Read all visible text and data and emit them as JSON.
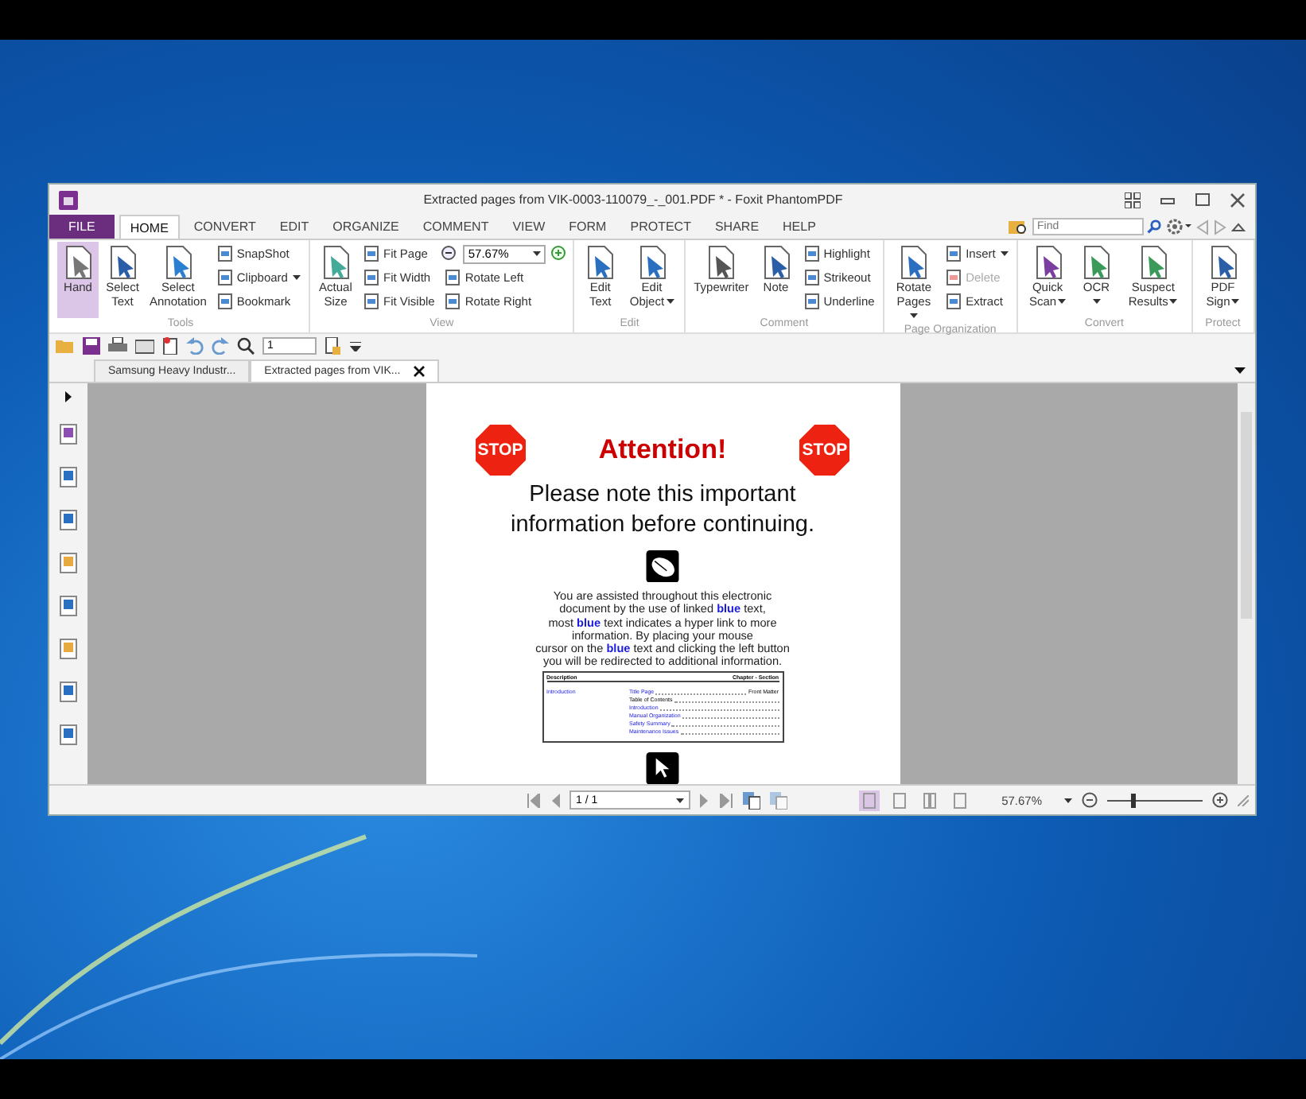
{
  "window": {
    "title": "Extracted pages from VIK-0003-110079_-_001.PDF * - Foxit PhantomPDF"
  },
  "menu_tabs": [
    {
      "label": "FILE",
      "kind": "file",
      "selected": false
    },
    {
      "label": "HOME",
      "kind": "tab",
      "selected": true
    },
    {
      "label": "CONVERT",
      "kind": "tab",
      "selected": false
    },
    {
      "label": "EDIT",
      "kind": "tab",
      "selected": false
    },
    {
      "label": "ORGANIZE",
      "kind": "tab",
      "selected": false
    },
    {
      "label": "COMMENT",
      "kind": "tab",
      "selected": false
    },
    {
      "label": "VIEW",
      "kind": "tab",
      "selected": false
    },
    {
      "label": "FORM",
      "kind": "tab",
      "selected": false
    },
    {
      "label": "PROTECT",
      "kind": "tab",
      "selected": false
    },
    {
      "label": "SHARE",
      "kind": "tab",
      "selected": false
    },
    {
      "label": "HELP",
      "kind": "tab",
      "selected": false
    }
  ],
  "search": {
    "placeholder": "Find"
  },
  "ribbon": [
    {
      "label": "Tools",
      "items": [
        {
          "kind": "big",
          "label": "Hand",
          "selected": true,
          "dropdown": false
        },
        {
          "kind": "big",
          "label": "Select Text",
          "selected": false,
          "dropdown": false
        },
        {
          "kind": "big",
          "label": "Select Annotation",
          "selected": false,
          "dropdown": false
        },
        {
          "kind": "column",
          "items": [
            {
              "kind": "small",
              "label": "SnapShot",
              "dropdown": false,
              "disabled": false
            },
            {
              "kind": "small",
              "label": "Clipboard",
              "dropdown": true,
              "disabled": false
            },
            {
              "kind": "small",
              "label": "Bookmark",
              "dropdown": false,
              "disabled": false
            }
          ]
        }
      ]
    },
    {
      "label": "View",
      "items": [
        {
          "kind": "big",
          "label": "Actual Size",
          "selected": false,
          "dropdown": false
        },
        {
          "kind": "column",
          "items": [
            {
              "kind": "small",
              "label": "Fit Page",
              "dropdown": false,
              "disabled": false
            },
            {
              "kind": "small",
              "label": "Fit Width",
              "dropdown": false,
              "disabled": false
            },
            {
              "kind": "small",
              "label": "Fit Visible",
              "dropdown": false,
              "disabled": false
            }
          ]
        },
        {
          "kind": "column",
          "items": [
            {
              "kind": "zoom",
              "value": "57.67%"
            },
            {
              "kind": "small",
              "label": "Rotate Left",
              "dropdown": false,
              "disabled": false
            },
            {
              "kind": "small",
              "label": "Rotate Right",
              "dropdown": false,
              "disabled": false
            }
          ]
        }
      ]
    },
    {
      "label": "Edit",
      "items": [
        {
          "kind": "big",
          "label": "Edit Text",
          "selected": false,
          "dropdown": false
        },
        {
          "kind": "big",
          "label": "Edit Object",
          "selected": false,
          "dropdown": true
        }
      ]
    },
    {
      "label": "Comment",
      "items": [
        {
          "kind": "big",
          "label": "Typewriter",
          "selected": false,
          "dropdown": false
        },
        {
          "kind": "big",
          "label": "Note",
          "selected": false,
          "dropdown": false
        },
        {
          "kind": "column",
          "items": [
            {
              "kind": "small",
              "label": "Highlight",
              "dropdown": false,
              "disabled": false
            },
            {
              "kind": "small",
              "label": "Strikeout",
              "dropdown": false,
              "disabled": false
            },
            {
              "kind": "small",
              "label": "Underline",
              "dropdown": false,
              "disabled": false
            }
          ]
        }
      ]
    },
    {
      "label": "Page Organization",
      "items": [
        {
          "kind": "big",
          "label": "Rotate Pages",
          "selected": false,
          "dropdown": true
        },
        {
          "kind": "column",
          "items": [
            {
              "kind": "small",
              "label": "Insert",
              "dropdown": true,
              "disabled": false
            },
            {
              "kind": "small",
              "label": "Delete",
              "dropdown": false,
              "disabled": true
            },
            {
              "kind": "small",
              "label": "Extract",
              "dropdown": false,
              "disabled": false
            }
          ]
        }
      ]
    },
    {
      "label": "Convert",
      "items": [
        {
          "kind": "big",
          "label": "Quick Scan",
          "selected": false,
          "dropdown": true
        },
        {
          "kind": "big",
          "label": "OCR",
          "selected": false,
          "dropdown": true
        },
        {
          "kind": "big",
          "label": "Suspect Results",
          "selected": false,
          "dropdown": true
        }
      ]
    },
    {
      "label": "Protect",
      "items": [
        {
          "kind": "big",
          "label": "PDF Sign",
          "selected": false,
          "dropdown": true
        }
      ]
    }
  ],
  "quick_toolbar": {
    "page_value": "1"
  },
  "doc_tabs": [
    {
      "label": "Samsung Heavy Industr...",
      "selected": false
    },
    {
      "label": "Extracted pages from VIK...",
      "selected": true
    }
  ],
  "document": {
    "stop_signs": [
      "STOP",
      "STOP"
    ],
    "heading": "Attention!",
    "subheading": "Please note this important information before continuing.",
    "paragraph": [
      "You are assisted throughout this electronic",
      "document by the use of linked **blue** text,",
      "most **blue** text indicates a hyper link to more",
      "information. By placing your mouse",
      "cursor on the **blue** text and clicking the left button",
      "you will be redirected to additional information."
    ],
    "contents": {
      "columns": [
        "Description",
        "Chapter - Section"
      ],
      "section": "Introduction",
      "rows": [
        {
          "label": "Title Page",
          "page": "Front Matter",
          "link": true
        },
        {
          "label": "Table of Contents",
          "link": false
        },
        {
          "label": "Introduction",
          "link": true
        },
        {
          "label": "Manual Organization",
          "link": true
        },
        {
          "label": "Safety Summary",
          "link": true
        },
        {
          "label": "Maintenance Issues",
          "link": true
        }
      ]
    }
  },
  "status_bar": {
    "page_value": "1 / 1",
    "view_modes": [
      {
        "selected": true
      },
      {
        "selected": false
      },
      {
        "selected": false
      },
      {
        "selected": false
      }
    ],
    "zoom": "57.67%",
    "zoom_level": {
      "level": 0.25
    }
  }
}
